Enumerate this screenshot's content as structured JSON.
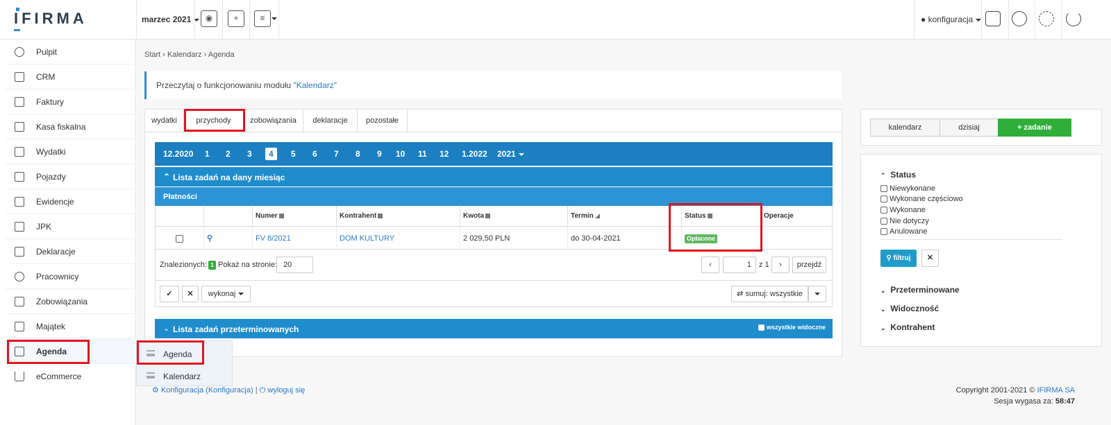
{
  "brand": {
    "logo": "IFIRMA"
  },
  "topbar": {
    "month": "marzec 2021",
    "user": "konfiguracja"
  },
  "sidebar": {
    "items": [
      {
        "label": "Pulpit",
        "icon": "dashboard-icon"
      },
      {
        "label": "CRM",
        "icon": "crm-icon"
      },
      {
        "label": "Faktury",
        "icon": "invoice-icon"
      },
      {
        "label": "Kasa fiskalna",
        "icon": "cash-register-icon"
      },
      {
        "label": "Wydatki",
        "icon": "expenses-icon"
      },
      {
        "label": "Pojazdy",
        "icon": "car-icon"
      },
      {
        "label": "Ewidencje",
        "icon": "records-icon"
      },
      {
        "label": "JPK",
        "icon": "jpk-icon"
      },
      {
        "label": "Deklaracje",
        "icon": "declarations-icon"
      },
      {
        "label": "Pracownicy",
        "icon": "employees-icon"
      },
      {
        "label": "Zobowiązania",
        "icon": "liabilities-icon"
      },
      {
        "label": "Majątek",
        "icon": "assets-icon"
      },
      {
        "label": "Agenda",
        "icon": "agenda-icon"
      },
      {
        "label": "eCommerce",
        "icon": "cart-icon"
      }
    ]
  },
  "submenu": {
    "items": [
      "Agenda",
      "Kalendarz"
    ]
  },
  "breadcrumb": {
    "start": "Start",
    "kal": "Kalendarz",
    "agenda": "Agenda"
  },
  "info": {
    "prefix": "Przeczytaj o funkcjonowaniu modułu",
    "link": "\"Kalendarz\""
  },
  "tabs": [
    "wydatki",
    "przychody",
    "zobowiązania",
    "deklaracje",
    "pozostałe"
  ],
  "months": [
    "12.2020",
    "1",
    "2",
    "3",
    "4",
    "5",
    "6",
    "7",
    "8",
    "9",
    "10",
    "11",
    "12",
    "1.2022",
    "2021"
  ],
  "lists": {
    "current": "Lista zadań na dany miesiąc",
    "section": "Płatności",
    "overdue": "Lista zadań przeterminowanych",
    "all_visible": "wszystkie widoczne"
  },
  "table": {
    "headers": [
      "",
      "",
      "Numer",
      "Kontrahent",
      "Kwota",
      "Termin",
      "Status",
      "Operacje"
    ],
    "row": {
      "numer": "FV 8/2021",
      "kontrahent": "DOM KULTURY",
      "kwota": "2 029,50 PLN",
      "termin": "do 30-04-2021",
      "status": "Opłacone"
    }
  },
  "pager": {
    "found_label": "Znalezionych:",
    "found_count": "1",
    "per_page_label": "Pokaż na stronie:",
    "per_page": "20",
    "page": "1",
    "of": "z 1",
    "go": "przejdź"
  },
  "actions": {
    "execute": "wykonaj",
    "sum": "sumuj: wszystkie"
  },
  "right": {
    "calendar": "kalendarz",
    "today": "dzisiaj",
    "add": "+ zadanie"
  },
  "filters": {
    "status_title": "Status",
    "options": [
      "Niewykonane",
      "Wykonane częściowo",
      "Wykonane",
      "Nie dotyczy",
      "Anulowane"
    ],
    "filter_btn": "filtruj",
    "sections": [
      "Przeterminowane",
      "Widoczność",
      "Kontrahent"
    ]
  },
  "footer": {
    "config": "Konfiguracja",
    "config_sub": "(Konfiguracja)",
    "logout": "wyloguj się",
    "copyright": "Copyright 2001-2021 ©",
    "company": "IFIRMA SA",
    "session_label": "Sesja wygasa za:",
    "session_time": "58:47"
  },
  "colors": {
    "primary": "#1f8ccb",
    "success": "#2fae3a",
    "highlight": "#e0151f"
  }
}
